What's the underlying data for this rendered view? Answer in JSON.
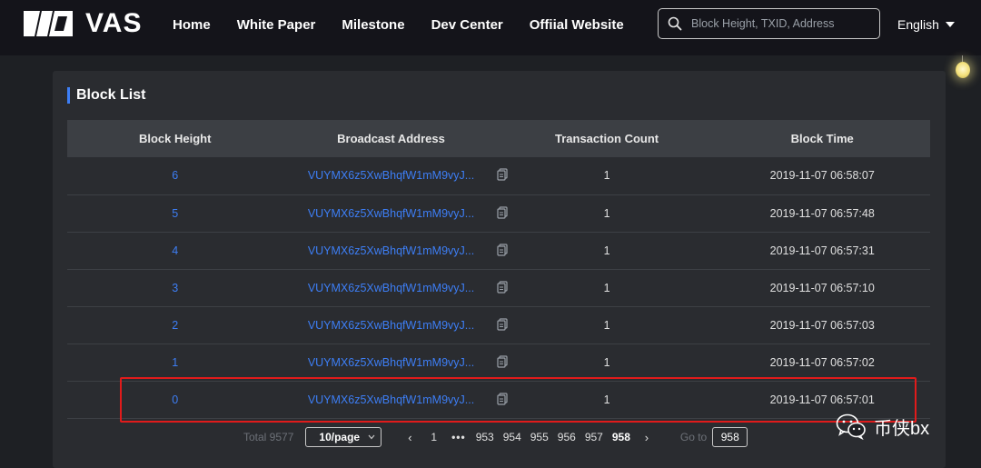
{
  "header": {
    "brand": "VAS",
    "nav": [
      "Home",
      "White Paper",
      "Milestone",
      "Dev Center",
      "Offiial Website"
    ],
    "search_placeholder": "Block Height, TXID, Address",
    "language": "English"
  },
  "panel": {
    "title": "Block List",
    "columns": [
      "Block Height",
      "Broadcast Address",
      "Transaction Count",
      "Block Time"
    ],
    "rows": [
      {
        "height": "6",
        "address": "VUYMX6z5XwBhqfW1mM9vyJ...",
        "count": "1",
        "time": "2019-11-07 06:58:07"
      },
      {
        "height": "5",
        "address": "VUYMX6z5XwBhqfW1mM9vyJ...",
        "count": "1",
        "time": "2019-11-07 06:57:48"
      },
      {
        "height": "4",
        "address": "VUYMX6z5XwBhqfW1mM9vyJ...",
        "count": "1",
        "time": "2019-11-07 06:57:31"
      },
      {
        "height": "3",
        "address": "VUYMX6z5XwBhqfW1mM9vyJ...",
        "count": "1",
        "time": "2019-11-07 06:57:10"
      },
      {
        "height": "2",
        "address": "VUYMX6z5XwBhqfW1mM9vyJ...",
        "count": "1",
        "time": "2019-11-07 06:57:03"
      },
      {
        "height": "1",
        "address": "VUYMX6z5XwBhqfW1mM9vyJ...",
        "count": "1",
        "time": "2019-11-07 06:57:02"
      },
      {
        "height": "0",
        "address": "VUYMX6z5XwBhqfW1mM9vyJ...",
        "count": "1",
        "time": "2019-11-07 06:57:01"
      }
    ]
  },
  "pagination": {
    "total": "Total 9577",
    "page_size": "10/page",
    "prev": "‹",
    "first": "1",
    "ellipsis": "•••",
    "pages": [
      "953",
      "954",
      "955",
      "956",
      "957"
    ],
    "current": "958",
    "next": "›",
    "goto_label": "Go to",
    "goto_value": "958"
  },
  "watermark": {
    "text": "币侠bx"
  },
  "colors": {
    "accent": "#3d7ef5",
    "highlight": "#e01b1b",
    "background": "#1e2024",
    "panel": "#2a2c30"
  },
  "icons": [
    "search-icon",
    "copy-icon",
    "chevron-down-icon",
    "lightbulb-icon",
    "wechat-icon"
  ]
}
